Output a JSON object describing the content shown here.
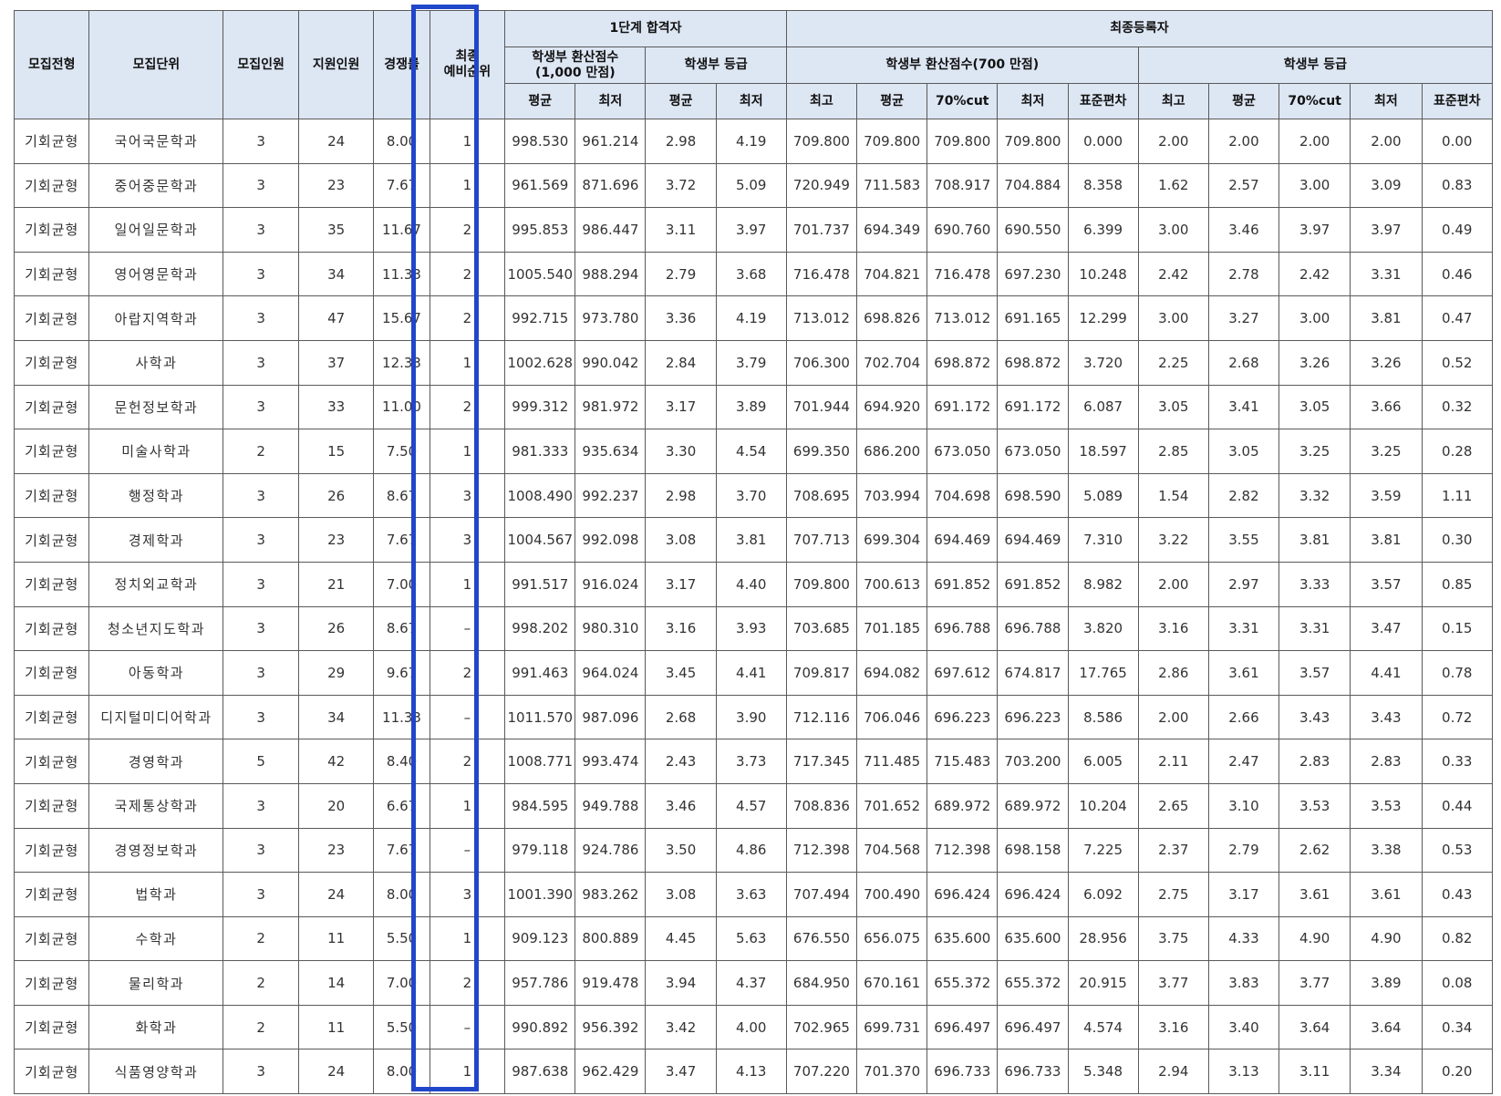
{
  "headers": {
    "col_type": "모집전형",
    "col_unit": "모집단위",
    "col_quota": "모집인원",
    "col_applicants": "지원인원",
    "col_ratio": "경쟁률",
    "col_waitlist": "최종\n예비순위",
    "group_stage1": "1단계 합격자",
    "group_final": "최종등록자",
    "sub_s1_score": "학생부 환산점수\n(1,000 만점)",
    "sub_s1_grade": "학생부 등급",
    "sub_f_score": "학생부 환산점수(700 만점)",
    "sub_f_grade": "학생부 등급",
    "avg": "평균",
    "min": "최저",
    "max": "최고",
    "cut70": "70%cut",
    "stdev": "표준편차"
  },
  "highlight": {
    "column": "최종 예비순위",
    "color": "#2046c9"
  },
  "rows": [
    [
      "기회균형",
      "국어국문학과",
      "3",
      "24",
      "8.00",
      "1",
      "998.530",
      "961.214",
      "2.98",
      "4.19",
      "709.800",
      "709.800",
      "709.800",
      "709.800",
      "0.000",
      "2.00",
      "2.00",
      "2.00",
      "2.00",
      "0.00"
    ],
    [
      "기회균형",
      "중어중문학과",
      "3",
      "23",
      "7.67",
      "1",
      "961.569",
      "871.696",
      "3.72",
      "5.09",
      "720.949",
      "711.583",
      "708.917",
      "704.884",
      "8.358",
      "1.62",
      "2.57",
      "3.00",
      "3.09",
      "0.83"
    ],
    [
      "기회균형",
      "일어일문학과",
      "3",
      "35",
      "11.67",
      "2",
      "995.853",
      "986.447",
      "3.11",
      "3.97",
      "701.737",
      "694.349",
      "690.760",
      "690.550",
      "6.399",
      "3.00",
      "3.46",
      "3.97",
      "3.97",
      "0.49"
    ],
    [
      "기회균형",
      "영어영문학과",
      "3",
      "34",
      "11.33",
      "2",
      "1005.540",
      "988.294",
      "2.79",
      "3.68",
      "716.478",
      "704.821",
      "716.478",
      "697.230",
      "10.248",
      "2.42",
      "2.78",
      "2.42",
      "3.31",
      "0.46"
    ],
    [
      "기회균형",
      "아랍지역학과",
      "3",
      "47",
      "15.67",
      "2",
      "992.715",
      "973.780",
      "3.36",
      "4.19",
      "713.012",
      "698.826",
      "713.012",
      "691.165",
      "12.299",
      "3.00",
      "3.27",
      "3.00",
      "3.81",
      "0.47"
    ],
    [
      "기회균형",
      "사학과",
      "3",
      "37",
      "12.33",
      "1",
      "1002.628",
      "990.042",
      "2.84",
      "3.79",
      "706.300",
      "702.704",
      "698.872",
      "698.872",
      "3.720",
      "2.25",
      "2.68",
      "3.26",
      "3.26",
      "0.52"
    ],
    [
      "기회균형",
      "문헌정보학과",
      "3",
      "33",
      "11.00",
      "2",
      "999.312",
      "981.972",
      "3.17",
      "3.89",
      "701.944",
      "694.920",
      "691.172",
      "691.172",
      "6.087",
      "3.05",
      "3.41",
      "3.05",
      "3.66",
      "0.32"
    ],
    [
      "기회균형",
      "미술사학과",
      "2",
      "15",
      "7.50",
      "1",
      "981.333",
      "935.634",
      "3.30",
      "4.54",
      "699.350",
      "686.200",
      "673.050",
      "673.050",
      "18.597",
      "2.85",
      "3.05",
      "3.25",
      "3.25",
      "0.28"
    ],
    [
      "기회균형",
      "행정학과",
      "3",
      "26",
      "8.67",
      "3",
      "1008.490",
      "992.237",
      "2.98",
      "3.70",
      "708.695",
      "703.994",
      "704.698",
      "698.590",
      "5.089",
      "1.54",
      "2.82",
      "3.32",
      "3.59",
      "1.11"
    ],
    [
      "기회균형",
      "경제학과",
      "3",
      "23",
      "7.67",
      "3",
      "1004.567",
      "992.098",
      "3.08",
      "3.81",
      "707.713",
      "699.304",
      "694.469",
      "694.469",
      "7.310",
      "3.22",
      "3.55",
      "3.81",
      "3.81",
      "0.30"
    ],
    [
      "기회균형",
      "정치외교학과",
      "3",
      "21",
      "7.00",
      "1",
      "991.517",
      "916.024",
      "3.17",
      "4.40",
      "709.800",
      "700.613",
      "691.852",
      "691.852",
      "8.982",
      "2.00",
      "2.97",
      "3.33",
      "3.57",
      "0.85"
    ],
    [
      "기회균형",
      "청소년지도학과",
      "3",
      "26",
      "8.67",
      "–",
      "998.202",
      "980.310",
      "3.16",
      "3.93",
      "703.685",
      "701.185",
      "696.788",
      "696.788",
      "3.820",
      "3.16",
      "3.31",
      "3.31",
      "3.47",
      "0.15"
    ],
    [
      "기회균형",
      "아동학과",
      "3",
      "29",
      "9.67",
      "2",
      "991.463",
      "964.024",
      "3.45",
      "4.41",
      "709.817",
      "694.082",
      "697.612",
      "674.817",
      "17.765",
      "2.86",
      "3.61",
      "3.57",
      "4.41",
      "0.78"
    ],
    [
      "기회균형",
      "디지털미디어학과",
      "3",
      "34",
      "11.33",
      "–",
      "1011.570",
      "987.096",
      "2.68",
      "3.90",
      "712.116",
      "706.046",
      "696.223",
      "696.223",
      "8.586",
      "2.00",
      "2.66",
      "3.43",
      "3.43",
      "0.72"
    ],
    [
      "기회균형",
      "경영학과",
      "5",
      "42",
      "8.40",
      "2",
      "1008.771",
      "993.474",
      "2.43",
      "3.73",
      "717.345",
      "711.485",
      "715.483",
      "703.200",
      "6.005",
      "2.11",
      "2.47",
      "2.83",
      "2.83",
      "0.33"
    ],
    [
      "기회균형",
      "국제통상학과",
      "3",
      "20",
      "6.67",
      "1",
      "984.595",
      "949.788",
      "3.46",
      "4.57",
      "708.836",
      "701.652",
      "689.972",
      "689.972",
      "10.204",
      "2.65",
      "3.10",
      "3.53",
      "3.53",
      "0.44"
    ],
    [
      "기회균형",
      "경영정보학과",
      "3",
      "23",
      "7.67",
      "–",
      "979.118",
      "924.786",
      "3.50",
      "4.86",
      "712.398",
      "704.568",
      "712.398",
      "698.158",
      "7.225",
      "2.37",
      "2.79",
      "2.62",
      "3.38",
      "0.53"
    ],
    [
      "기회균형",
      "법학과",
      "3",
      "24",
      "8.00",
      "3",
      "1001.390",
      "983.262",
      "3.08",
      "3.63",
      "707.494",
      "700.490",
      "696.424",
      "696.424",
      "6.092",
      "2.75",
      "3.17",
      "3.61",
      "3.61",
      "0.43"
    ],
    [
      "기회균형",
      "수학과",
      "2",
      "11",
      "5.50",
      "1",
      "909.123",
      "800.889",
      "4.45",
      "5.63",
      "676.550",
      "656.075",
      "635.600",
      "635.600",
      "28.956",
      "3.75",
      "4.33",
      "4.90",
      "4.90",
      "0.82"
    ],
    [
      "기회균형",
      "물리학과",
      "2",
      "14",
      "7.00",
      "2",
      "957.786",
      "919.478",
      "3.94",
      "4.37",
      "684.950",
      "670.161",
      "655.372",
      "655.372",
      "20.915",
      "3.77",
      "3.83",
      "3.77",
      "3.89",
      "0.08"
    ],
    [
      "기회균형",
      "화학과",
      "2",
      "11",
      "5.50",
      "–",
      "990.892",
      "956.392",
      "3.42",
      "4.00",
      "702.965",
      "699.731",
      "696.497",
      "696.497",
      "4.574",
      "3.16",
      "3.40",
      "3.64",
      "3.64",
      "0.34"
    ],
    [
      "기회균형",
      "식품영양학과",
      "3",
      "24",
      "8.00",
      "1",
      "987.638",
      "962.429",
      "3.47",
      "4.13",
      "707.220",
      "701.370",
      "696.733",
      "696.733",
      "5.348",
      "2.94",
      "3.13",
      "3.11",
      "3.34",
      "0.20"
    ]
  ]
}
